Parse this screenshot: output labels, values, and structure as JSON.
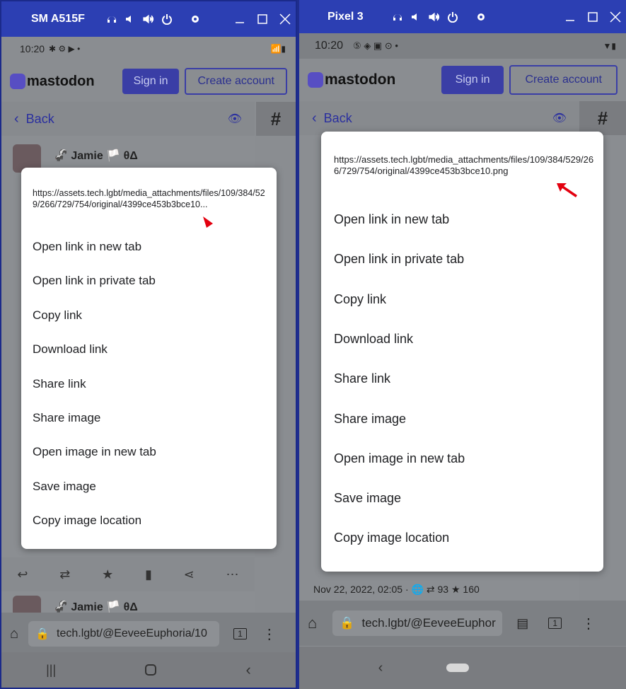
{
  "left": {
    "window_title": "SM A515F",
    "status_time": "10:20",
    "app": {
      "logo": "mastodon",
      "sign_in": "Sign in",
      "create_account": "Create account",
      "back": "Back",
      "author": "Jamie",
      "author_suffix": "θΔ",
      "url_bar": "tech.lgbt/@EeveeEuphoria/10",
      "tab_count": "1",
      "feed_author_2": "Jamie",
      "feed_author_2_suffix": "θΔ"
    },
    "menu": {
      "url": "https://assets.tech.lgbt/media_attachments/files/109/384/529/266/729/754/original/4399ce453b3bce10...",
      "items": [
        "Open link in new tab",
        "Open link in private tab",
        "Copy link",
        "Download link",
        "Share link",
        "Share image",
        "Open image in new tab",
        "Save image",
        "Copy image location"
      ]
    }
  },
  "right": {
    "window_title": "Pixel 3",
    "status_time": "10:20",
    "app": {
      "logo": "mastodon",
      "sign_in": "Sign in",
      "create_account": "Create account",
      "back": "Back",
      "post_meta": "Nov 22, 2022, 02:05 · ",
      "boosts": "93",
      "favs": "160",
      "url_bar": "tech.lgbt/@EeveeEuphor",
      "tab_count": "1"
    },
    "menu": {
      "url": "https://assets.tech.lgbt/media_attachments/files/109/384/529/266/729/754/original/4399ce453b3bce10.png",
      "items": [
        "Open link in new tab",
        "Open link in private tab",
        "Copy link",
        "Download link",
        "Share link",
        "Share image",
        "Open image in new tab",
        "Save image",
        "Copy image location"
      ]
    }
  },
  "colors": {
    "accent": "#2c3fb3",
    "arrow": "#e3000f",
    "brand": "#3a3ea6"
  }
}
